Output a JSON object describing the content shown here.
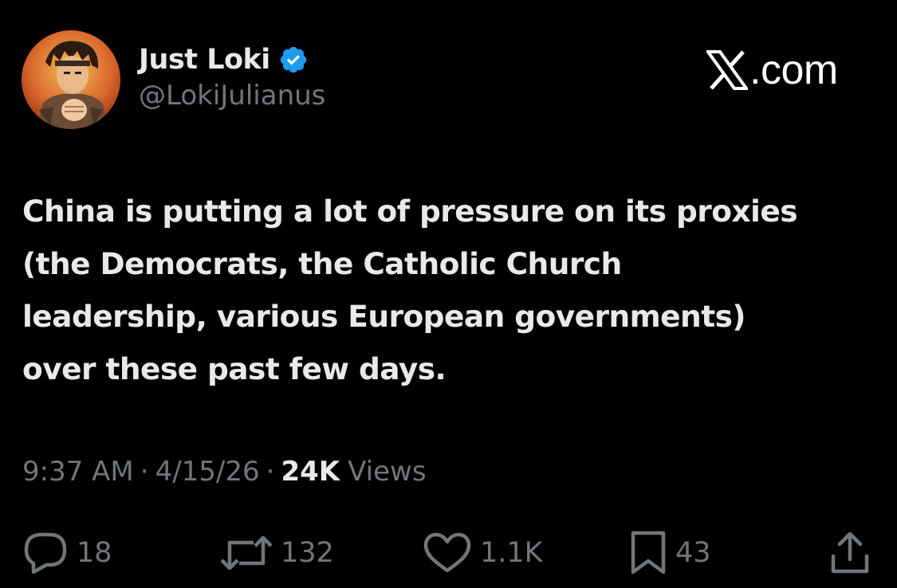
{
  "author": {
    "display_name": "Just Loki",
    "handle": "@LokiJulianus",
    "verified": true,
    "avatar_icon": "avatar-illustration",
    "verified_icon": "verified-badge-icon"
  },
  "brand": {
    "text": ".com",
    "logo_icon": "x-logo-icon"
  },
  "tweet": {
    "text": "China is putting a lot of pressure on its proxies\n(the Democrats, the Catholic Church\nleadership, various European governments)\nover these past few days."
  },
  "meta": {
    "time": "9:37 AM",
    "separator": "·",
    "date": "4/15/26",
    "views_count": "24K",
    "views_label": "Views"
  },
  "actions": {
    "replies": "18",
    "reposts": "132",
    "likes": "1.1K",
    "bookmarks": "43",
    "icons": [
      "reply-icon",
      "repost-icon",
      "like-icon",
      "bookmark-icon",
      "share-icon"
    ]
  },
  "colors": {
    "background": "#000000",
    "primary_text": "#e7e9ea",
    "secondary_text": "#71767b",
    "verified_blue": "#1d9bf0"
  }
}
